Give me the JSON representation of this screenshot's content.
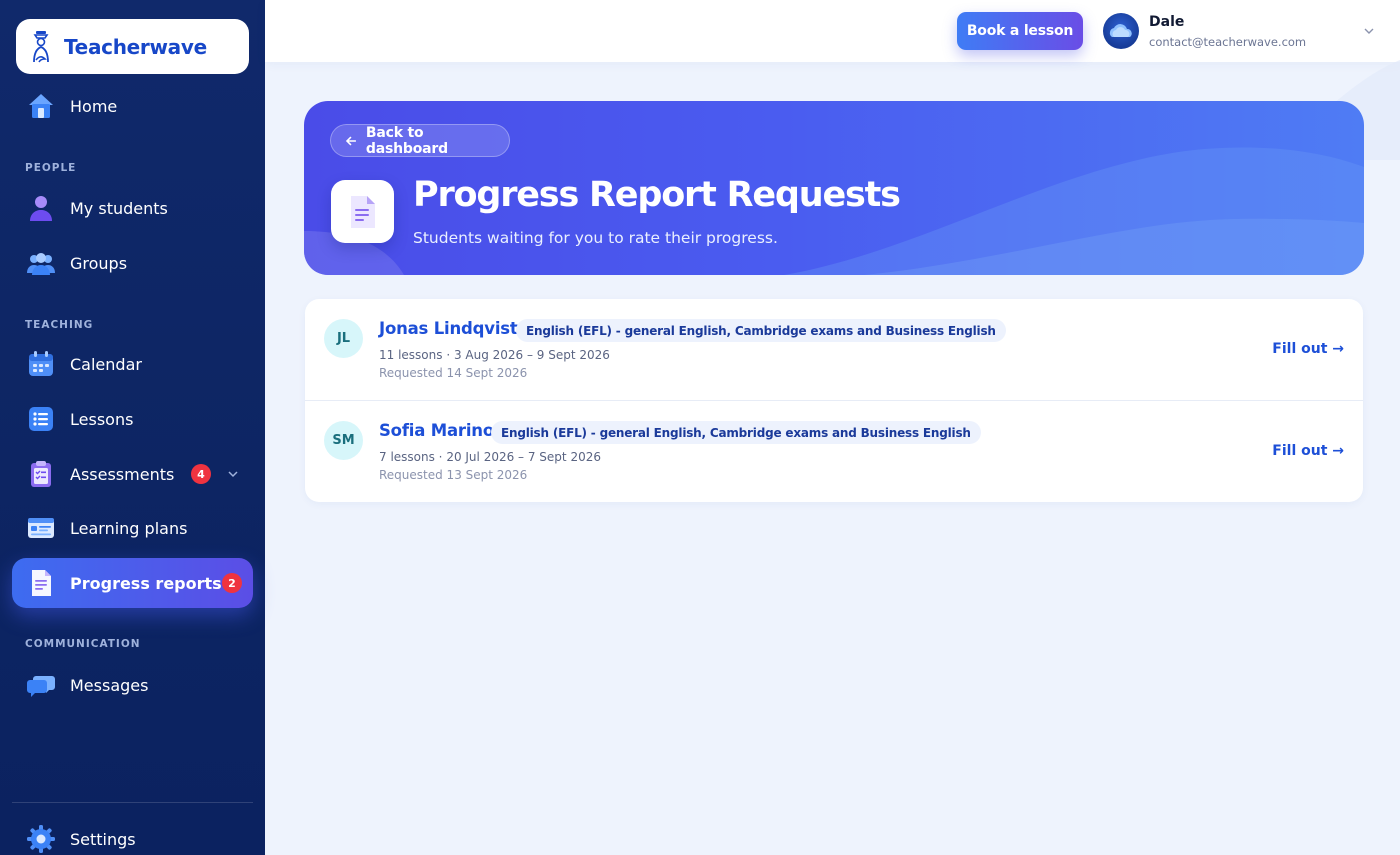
{
  "brand": {
    "name": "Teacherwave"
  },
  "sidebar": {
    "sections": {
      "people": "PEOPLE",
      "teaching": "TEACHING",
      "communication": "COMMUNICATION"
    },
    "items": [
      {
        "label": "Home",
        "icon": "home-icon"
      },
      {
        "label": "My students",
        "icon": "student-icon"
      },
      {
        "label": "Groups",
        "icon": "groups-icon"
      },
      {
        "label": "Calendar",
        "icon": "calendar-icon"
      },
      {
        "label": "Lessons",
        "icon": "list-icon"
      },
      {
        "label": "Assessments",
        "icon": "clipboard-icon",
        "badge": "4"
      },
      {
        "label": "Learning plans",
        "icon": "learning-plan-icon"
      },
      {
        "label": "Progress reports",
        "icon": "document-icon",
        "badge": "2",
        "active": true
      },
      {
        "label": "Messages",
        "icon": "chat-bubbles-icon"
      },
      {
        "label": "Settings",
        "icon": "gear-icon"
      }
    ]
  },
  "header": {
    "book_label": "Book a lesson",
    "user": {
      "name": "Dale",
      "email": "contact@teacherwave.com"
    }
  },
  "hero": {
    "back_label": "Back to dashboard",
    "title": "Progress Report Requests",
    "subtitle": "Students waiting for you to rate their progress."
  },
  "requests": [
    {
      "initials": "JL",
      "name": "Jonas Lindqvist",
      "course": "English (EFL) - general English, Cambridge exams and Business English",
      "meta": "11 lessons · 3 Aug 2026 – 9 Sept 2026",
      "requested": "Requested 14 Sept 2026",
      "action": "Fill out →"
    },
    {
      "initials": "SM",
      "name": "Sofia Marino",
      "course": "English (EFL) - general English, Cambridge exams and Business English",
      "meta": "7 lessons · 20 Jul 2026 – 7 Sept 2026",
      "requested": "Requested 13 Sept 2026",
      "action": "Fill out →"
    }
  ],
  "colors": {
    "sidebar_bg": "#0d2563",
    "accent": "#1d4fd7",
    "badge": "#ef3340",
    "hero_start": "#4a4ce8",
    "hero_end": "#4f7cf4"
  }
}
